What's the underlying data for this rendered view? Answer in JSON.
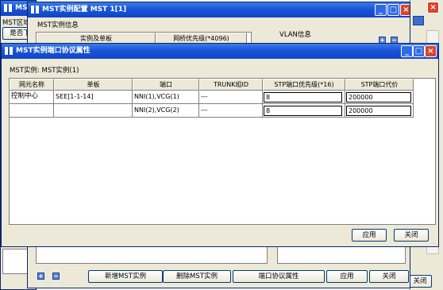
{
  "bg_window": {
    "title": "MSTP",
    "region_label": "MST区域配",
    "is_button": "是否下"
  },
  "mid_window": {
    "title": "MST实例配置 MST 1[1]",
    "group_label": "MST实例信息",
    "col_instance_board": "实例及单板",
    "col_bridge_priority": "网桥优先级(*4096)",
    "vlan_label": "VLAN信息",
    "btn_add_instance": "新增MST实例",
    "btn_delete_instance": "删除MST实例",
    "btn_port_protocol": "端口协议属性",
    "btn_apply": "应用",
    "btn_close": "关闭"
  },
  "bg_close_button": "关闭",
  "front_window": {
    "title": "MST实例端口协议属性",
    "instance_label": "MST实例: MST实例(1)",
    "headers": [
      "网元名称",
      "单板",
      "端口",
      "TRUNK组ID",
      "STP端口优先级(*16)",
      "STP端口代价"
    ],
    "rows": [
      {
        "ne": "控制中心",
        "board": "SEE[1-1-14]",
        "port": "NNI(1),VCG(1)",
        "trunk": "---",
        "priority": "8",
        "cost": "200000"
      },
      {
        "ne": "",
        "board": "",
        "port": "NNI(2),VCG(2)",
        "trunk": "---",
        "priority": "8",
        "cost": "200000"
      }
    ],
    "btn_apply": "应用",
    "btn_close": "关闭"
  },
  "colors": {
    "titlebar": "#1a55d6",
    "window_face": "#ece9d8",
    "close_button": "#d8452c"
  }
}
